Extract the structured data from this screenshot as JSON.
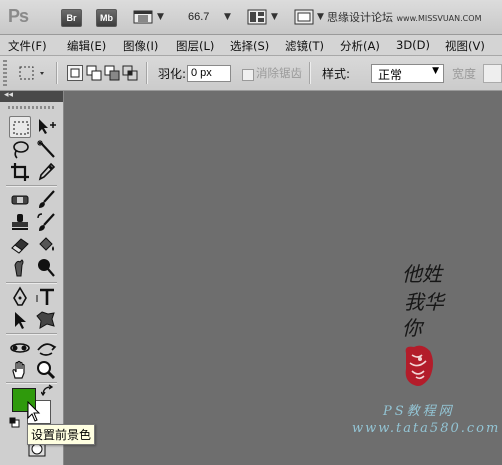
{
  "app": {
    "logo": "Ps",
    "bridge_btn": "Br",
    "minibridge_btn": "Mb",
    "zoom": "66.7",
    "watermark_cn": "思缘设计论坛",
    "watermark_en": "www.MISSVUAN.COM"
  },
  "menus": [
    "文件(F)",
    "编辑(E)",
    "图像(I)",
    "图层(L)",
    "选择(S)",
    "滤镜(T)",
    "分析(A)",
    "3D(D)",
    "视图(V)"
  ],
  "options": {
    "feather_label": "羽化:",
    "feather_value": "0 px",
    "antialias_label": "消除锯齿",
    "style_label": "样式:",
    "style_value": "正常",
    "width_label": "宽度"
  },
  "colors": {
    "foreground": "#2f9a0c",
    "background": "#ffffff"
  },
  "tooltip": "设置前景色",
  "canvas_watermark": {
    "line1": "PS教程网",
    "line2": "www.tata580.com"
  },
  "signature_text": [
    "他姓",
    "我华",
    "你"
  ]
}
